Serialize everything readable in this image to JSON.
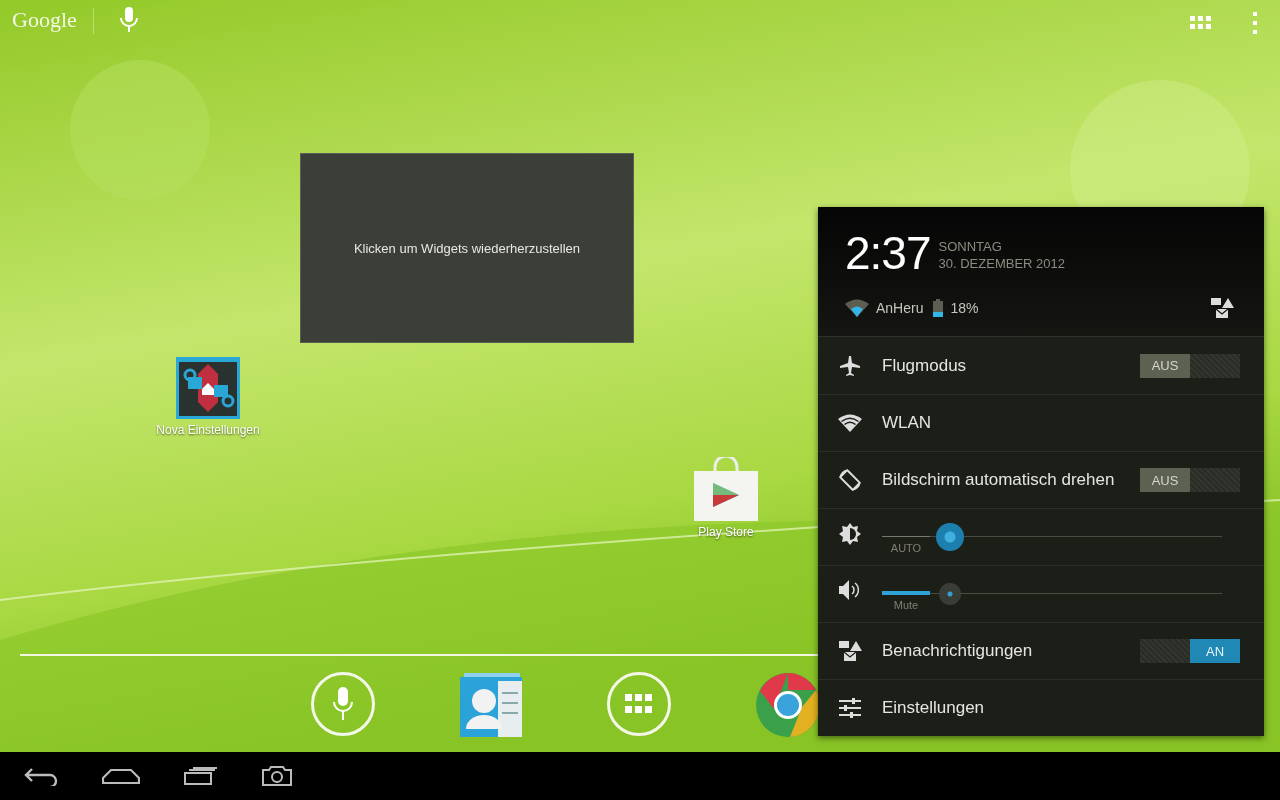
{
  "top_bar": {
    "logo": "Google"
  },
  "widget_placeholder": {
    "text": "Klicken um Widgets wiederherzustellen"
  },
  "desktop_icons": [
    {
      "label": "Nova Einstellungen"
    },
    {
      "label": "Play Store"
    }
  ],
  "quick_settings": {
    "time": "2:37",
    "day": "SONNTAG",
    "date": "30. DEZEMBER 2012",
    "network": "AnHeru",
    "battery": "18%",
    "rows": [
      {
        "kind": "toggle",
        "label": "Flugmodus",
        "switch": {
          "label": "AUS",
          "on": false
        }
      },
      {
        "kind": "plain",
        "label": "WLAN"
      },
      {
        "kind": "toggle",
        "label": "Bildschirm automatisch drehen",
        "switch": {
          "label": "AUS",
          "on": false
        }
      },
      {
        "kind": "slider",
        "caption": "AUTO",
        "auto": true,
        "level": 0.2
      },
      {
        "kind": "slider",
        "caption": "Mute",
        "auto": false,
        "level": 0.2
      },
      {
        "kind": "toggle",
        "label": "Benachrichtigungen",
        "switch": {
          "label": "AN",
          "on": true
        }
      },
      {
        "kind": "plain",
        "label": "Einstellungen"
      }
    ]
  }
}
